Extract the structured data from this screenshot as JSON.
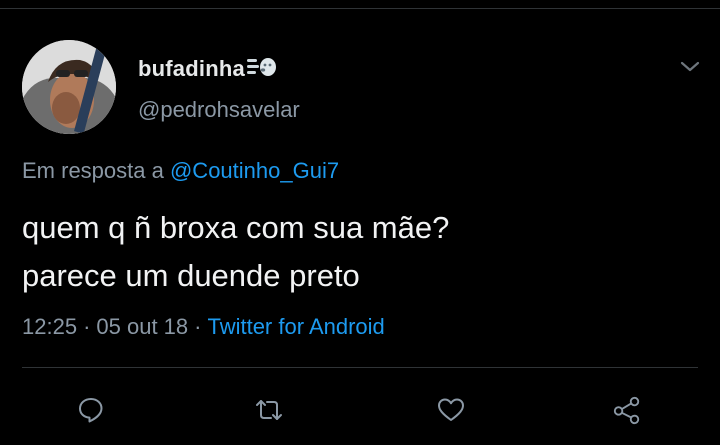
{
  "tweet": {
    "display_name": "bufadinha",
    "display_name_emoji": "wind-face-emoji",
    "handle": "@pedrohsavelar",
    "reply_prefix": "Em resposta a",
    "reply_mention": "@Coutinho_Gui7",
    "text_line1": "quem q ñ broxa com sua mãe?",
    "text_line2": "parece um duende preto",
    "time": "12:25",
    "date": "05 out 18",
    "source": "Twitter for Android",
    "separator": "·"
  },
  "actions": [
    {
      "name": "reply",
      "icon": "reply-icon"
    },
    {
      "name": "retweet",
      "icon": "retweet-icon"
    },
    {
      "name": "like",
      "icon": "heart-icon"
    },
    {
      "name": "share",
      "icon": "share-icon"
    }
  ],
  "colors": {
    "background": "#000000",
    "text_primary": "#e7e9ea",
    "text_secondary": "#8b98a5",
    "link": "#1d9bf0",
    "divider": "#2f3336"
  }
}
